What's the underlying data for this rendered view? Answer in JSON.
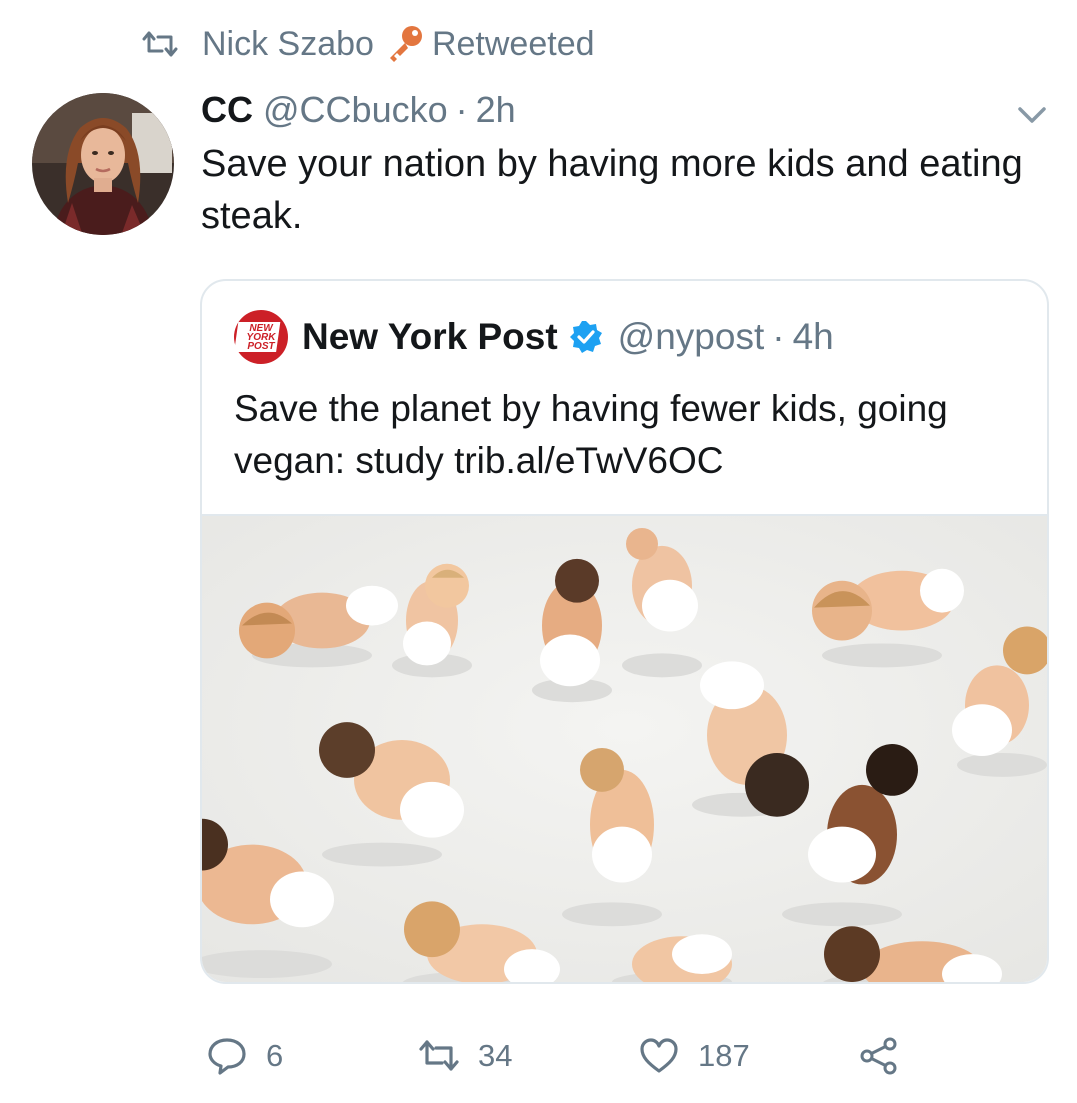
{
  "retweet_context": {
    "user": "Nick Szabo",
    "label": "Retweeted"
  },
  "tweet": {
    "display_name": "CC",
    "handle": "@CCbucko",
    "separator": "·",
    "time": "2h",
    "text": "Save your nation by having more kids and eating steak."
  },
  "quoted_tweet": {
    "logo_text": [
      "NEW",
      "YORK",
      "POST"
    ],
    "display_name": "New York Post",
    "handle": "@nypost",
    "separator": "·",
    "time": "4h",
    "text": "Save the planet by having fewer kids, going vegan: study trib.al/eTwV6OC",
    "media_alt": "photo of many babies in diapers crawling on a white floor"
  },
  "actions": {
    "replies": "6",
    "retweets": "34",
    "likes": "187"
  },
  "colors": {
    "text_primary": "#14171a",
    "text_secondary": "#657786",
    "border": "#e1e8ed",
    "verified": "#1da1f2",
    "nypost_red": "#cc2027",
    "key_orange": "#e3763f"
  },
  "icons": [
    "retweet-icon",
    "key-emoji-icon",
    "chevron-down-icon",
    "verified-badge-icon",
    "reply-icon",
    "like-icon",
    "share-icon"
  ]
}
